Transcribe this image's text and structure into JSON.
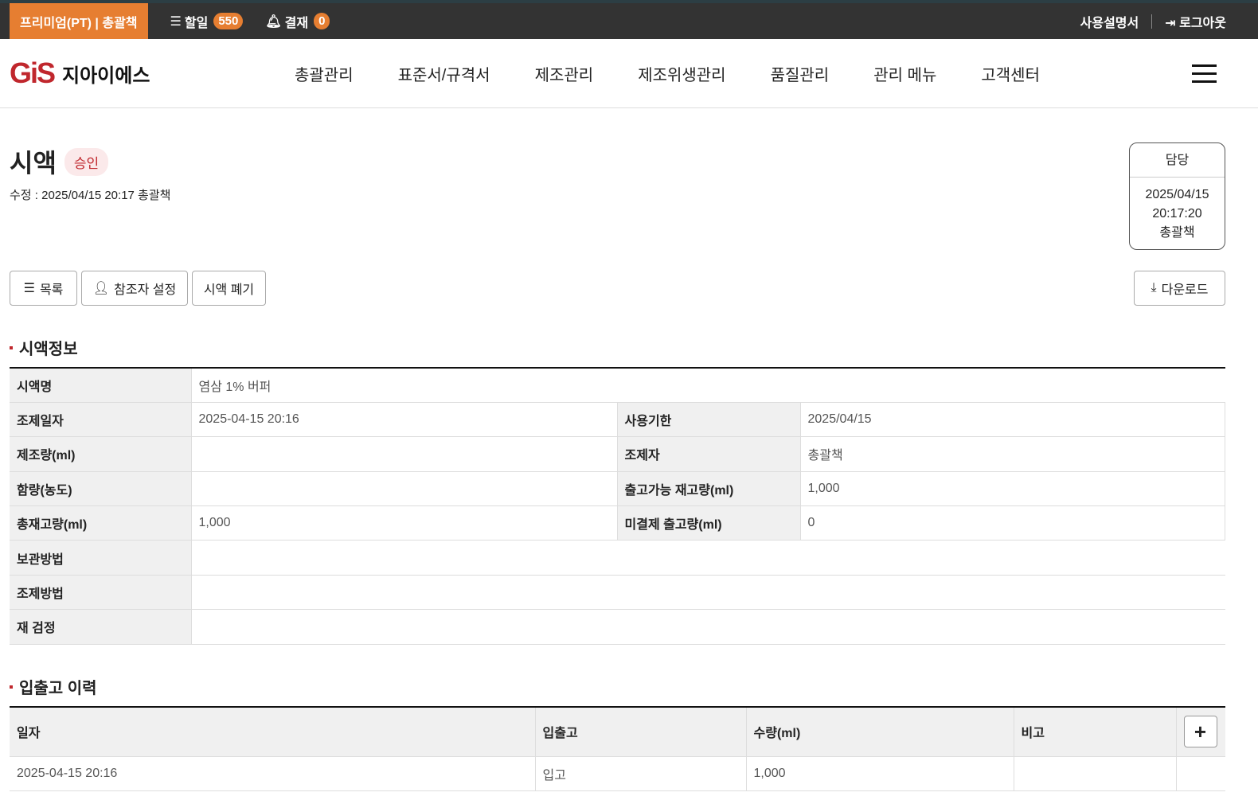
{
  "topbar": {
    "plan": "프리미엄(PT) | 총괄책",
    "todo_label": "할일",
    "todo_count": "550",
    "approval_label": "결재",
    "approval_count": "0",
    "manual": "사용설명서",
    "logout": "로그아웃"
  },
  "nav": {
    "logo_mark": "GiS",
    "logo_text": "지아이에스",
    "menu": [
      "총괄관리",
      "표준서/규격서",
      "제조관리",
      "제조위생관리",
      "품질관리",
      "관리 메뉴",
      "고객센터"
    ]
  },
  "page": {
    "title": "시액",
    "status": "승인",
    "modified": "수정 : 2025/04/15 20:17  총괄책"
  },
  "approval_box": {
    "header": "담당",
    "date": "2025/04/15",
    "time": "20:17:20",
    "person": "총괄책"
  },
  "buttons": {
    "list": "목록",
    "participants": "참조자 설정",
    "discard": "시액 폐기",
    "download": "다운로드"
  },
  "info": {
    "title": "시액정보",
    "name_label": "시액명",
    "name": "염삼 1% 버퍼",
    "rows": [
      {
        "l1": "조제일자",
        "v1": "2025-04-15 20:16",
        "l2": "사용기한",
        "v2": "2025/04/15"
      },
      {
        "l1": "제조량(ml)",
        "v1": "",
        "l2": "조제자",
        "v2": "총괄책"
      },
      {
        "l1": "함량(농도)",
        "v1": "",
        "l2": "출고가능 재고량(ml)",
        "v2": "1,000"
      },
      {
        "l1": "총재고량(ml)",
        "v1": "1,000",
        "l2": "미결제 출고량(ml)",
        "v2": "0"
      }
    ],
    "full_rows": [
      {
        "l": "보관방법",
        "v": ""
      },
      {
        "l": "조제방법",
        "v": ""
      },
      {
        "l": "재 검정",
        "v": ""
      }
    ]
  },
  "history": {
    "title": "입출고 이력",
    "columns": [
      "일자",
      "입출고",
      "수량(ml)",
      "비고"
    ],
    "rows": [
      {
        "date": "2025-04-15 20:16",
        "type": "입고",
        "qty": "1,000",
        "note": ""
      }
    ]
  }
}
